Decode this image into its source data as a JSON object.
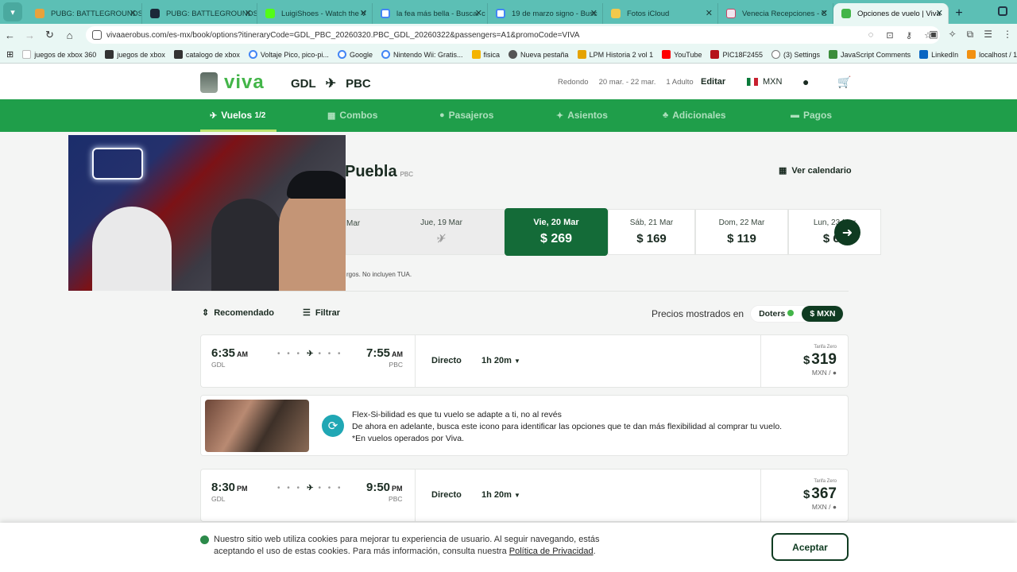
{
  "browser": {
    "tabs": [
      {
        "title": "PUBG: BATTLEGROUNDS",
        "color": "#e8a23c"
      },
      {
        "title": "PUBG: BATTLEGROUNDS",
        "color": "#1b2838"
      },
      {
        "title": "LuigiShoes - Watch the V",
        "color": "#53fc18"
      },
      {
        "title": "la fea más bella - Buscar c",
        "color": "#ffffff"
      },
      {
        "title": "19 de marzo signo - Busc",
        "color": "#ffffff"
      },
      {
        "title": "Fotos iCloud",
        "color": "#f2c94c"
      },
      {
        "title": "Venecia Recepciones - C",
        "color": "#f0e6ef"
      },
      {
        "title": "Opciones de vuelo | Viva",
        "color": "#43b549",
        "active": true
      }
    ],
    "url": "vivaaerobus.com/es-mx/book/options?itineraryCode=GDL_PBC_20260320.PBC_GDL_20260322&passengers=A1&promoCode=VIVA",
    "bookmarks": [
      "juegos de xbox 360",
      "juegos de xbox",
      "catalogo de xbox",
      "Voltaje Pico, pico-pi...",
      "Google",
      "Nintendo Wii: Gratis...",
      "fisica",
      "Nueva pestaña",
      "LPM Historia 2 vol 1",
      "YouTube",
      "PIC18F2455",
      "(3) Settings",
      "JavaScript Comments",
      "LinkedIn",
      "localhost / 127.0.0.1..."
    ]
  },
  "header": {
    "logo": "viva",
    "origin": "GDL",
    "destination": "PBC",
    "trip_type": "Redondo",
    "dates": "20 mar. - 22 mar.",
    "passengers": "1 Adulto",
    "edit_label": "Editar",
    "currency": "MXN"
  },
  "steps": [
    {
      "label": "Vuelos",
      "extra": "1/2",
      "icon": "plane-icon",
      "active": true
    },
    {
      "label": "Combos",
      "icon": "combo-icon"
    },
    {
      "label": "Pasajeros",
      "icon": "person-icon"
    },
    {
      "label": "Asientos",
      "icon": "seat-icon"
    },
    {
      "label": "Adicionales",
      "icon": "bag-icon"
    },
    {
      "label": "Pagos",
      "icon": "card-icon"
    }
  ],
  "title": {
    "city": "Puebla",
    "code": "PBC",
    "calendar_link": "Ver calendario"
  },
  "dates": [
    {
      "day": "Mar",
      "price": "",
      "state": "disabled"
    },
    {
      "day": "Jue, 19 Mar",
      "price": "",
      "state": "disabled"
    },
    {
      "day": "Vie, 20 Mar",
      "price": "269",
      "state": "selected"
    },
    {
      "day": "Sáb, 21 Mar",
      "price": "169",
      "state": "normal"
    },
    {
      "day": "Dom, 22 Mar",
      "price": "119",
      "state": "normal"
    },
    {
      "day": "Lun, 23 Mar",
      "price": "69",
      "state": "normal"
    }
  ],
  "disclaimer": "rgos. No incluyen TUA.",
  "sort": {
    "recommended": "Recomendado",
    "filter": "Filtrar",
    "prices_shown": "Precios mostrados en",
    "doters": "Doters",
    "mxn": "$ MXN"
  },
  "flights": [
    {
      "dep_time": "6:35",
      "dep_ampm": "AM",
      "dep_code": "GDL",
      "arr_time": "7:55",
      "arr_ampm": "AM",
      "arr_code": "PBC",
      "stops": "Directo",
      "duration": "1h 20m",
      "fare_label": "Tarifa Zero",
      "price": "319",
      "per": "MXN /"
    },
    {
      "dep_time": "8:30",
      "dep_ampm": "PM",
      "dep_code": "GDL",
      "arr_time": "9:50",
      "arr_ampm": "PM",
      "arr_code": "PBC",
      "stops": "Directo",
      "duration": "1h 20m",
      "fare_label": "Tarifa Zero",
      "price": "367",
      "per": "MXN /"
    }
  ],
  "promo": {
    "line1": "Flex-Si-bilidad es que tu vuelo se adapte a ti, no al revés",
    "line2": "De ahora en adelante, busca este icono para identificar las opciones que te dan más flexibilidad al comprar tu vuelo.",
    "line3": "*En vuelos operados por Viva."
  },
  "cookie": {
    "text": "Nuestro sitio web utiliza cookies para mejorar tu experiencia de usuario. Al seguir navegando, estás aceptando el uso de estas cookies. Para más información, consulta nuestra",
    "link": "Política de Privacidad",
    "accept": "Aceptar"
  },
  "colors": {
    "brand_green": "#43b549",
    "nav_green": "#1f9e4a",
    "dark_green": "#146b38",
    "tab_teal": "#5cbfb5"
  }
}
